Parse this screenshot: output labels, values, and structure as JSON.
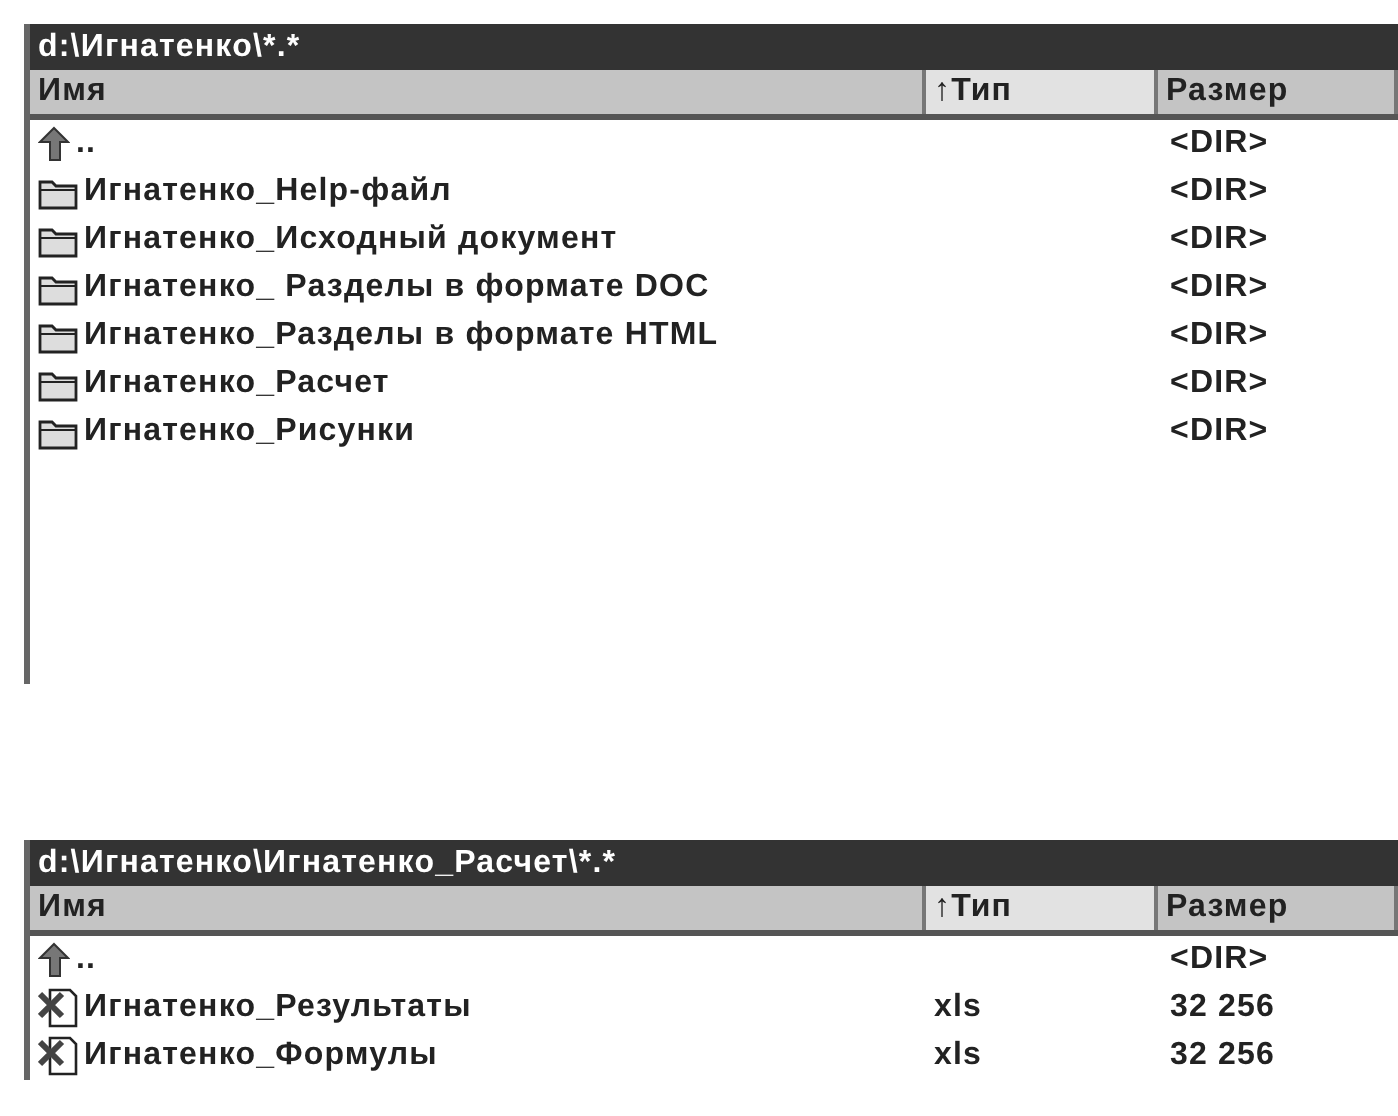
{
  "panels": [
    {
      "title": "d:\\Игнатенко\\*.*",
      "columns": [
        {
          "label": "Имя",
          "selected": false
        },
        {
          "label": "↑Тип",
          "selected": true
        },
        {
          "label": "Размер",
          "selected": false
        }
      ],
      "rows": [
        {
          "kind": "up",
          "name": "..",
          "type": "",
          "size": "<DIR>"
        },
        {
          "kind": "folder",
          "name": "Игнатенко_Help-файл",
          "type": "",
          "size": "<DIR>"
        },
        {
          "kind": "folder",
          "name": "Игнатенко_Исходный документ",
          "type": "",
          "size": "<DIR>"
        },
        {
          "kind": "folder",
          "name": "Игнатенко_ Разделы в формате DOC",
          "type": "",
          "size": "<DIR>"
        },
        {
          "kind": "folder",
          "name": "Игнатенко_Разделы в формате HTML",
          "type": "",
          "size": "<DIR>"
        },
        {
          "kind": "folder",
          "name": "Игнатенко_Расчет",
          "type": "",
          "size": "<DIR>"
        },
        {
          "kind": "folder",
          "name": "Игнатенко_Рисунки",
          "type": "",
          "size": "<DIR>"
        }
      ]
    },
    {
      "title": "d:\\Игнатенко\\Игнатенко_Расчет\\*.*",
      "columns": [
        {
          "label": "Имя",
          "selected": false
        },
        {
          "label": "↑Тип",
          "selected": true
        },
        {
          "label": "Размер",
          "selected": false
        }
      ],
      "rows": [
        {
          "kind": "up",
          "name": "..",
          "type": "",
          "size": "<DIR>"
        },
        {
          "kind": "xls",
          "name": "Игнатенко_Результаты",
          "type": "xls",
          "size": "32 256"
        },
        {
          "kind": "xls",
          "name": "Игнатенко_Формулы",
          "type": "xls",
          "size": "32 256"
        }
      ]
    }
  ]
}
